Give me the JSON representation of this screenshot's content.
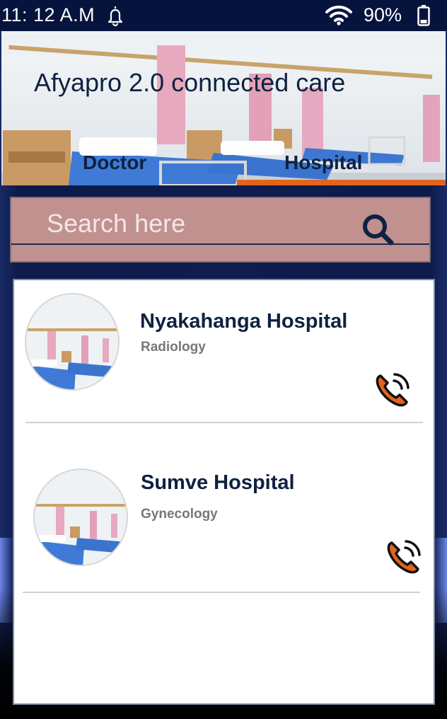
{
  "status_bar": {
    "time": "11: 12 A.M",
    "battery": "90%",
    "icons": [
      "bell-icon",
      "wifi-icon",
      "battery-icon"
    ]
  },
  "header": {
    "title": "Afyapro 2.0 connected care",
    "tabs": [
      {
        "label": "Doctor",
        "active": false
      },
      {
        "label": "Hospital",
        "active": true
      }
    ]
  },
  "search": {
    "placeholder": "Search here",
    "value": ""
  },
  "hospitals": [
    {
      "name": "Nyakahanga Hospital",
      "department": "Radiology"
    },
    {
      "name": "Sumve Hospital",
      "department": "Gynecology"
    }
  ],
  "colors": {
    "accent": "#e2641c",
    "navy": "#0e2240",
    "search_bg": "#c19190",
    "status_bar": "#06143d"
  }
}
